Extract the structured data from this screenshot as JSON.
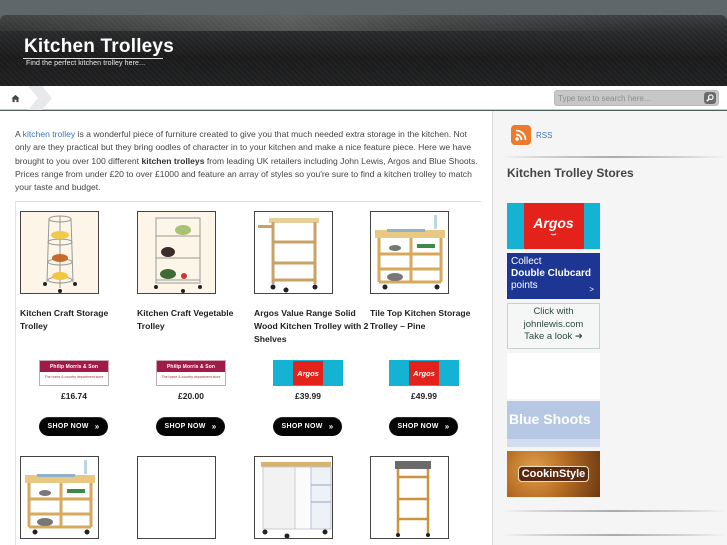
{
  "header": {
    "site_title": "Kitchen Trolleys",
    "tagline": "Find the perfect kitchen trolley here..."
  },
  "navbar": {
    "home_icon": "home-icon",
    "search": {
      "placeholder": "Type text to search here...",
      "value": "",
      "button_icon": "search-icon"
    }
  },
  "intro": {
    "prefix": "A ",
    "link_text": "kitchen trolley",
    "part1": " is a wonderful piece of furniture created to give you that much needed extra storage in the kitchen. Not only are they practical but they bring oodles of character in to your kitchen and make a nice feature piece. Here we have brought to you over 100 different ",
    "bold_text": "kitchen trolleys",
    "part2": " from leading UK retailers including John Lewis, Argos and Blue Shoots. Prices range from under £20 to over £1000 and feature an array of styles so you're sure to find a kitchen trolley to match your taste and budget."
  },
  "products": [
    {
      "name": "Kitchen Craft Storage Trolley",
      "retailer": "Philip Morris & Son",
      "retailer_sub": "The home & country department store",
      "price": "£16.74",
      "shop_label": "SHOP NOW",
      "shop_icon": "double-chevron-right-icon",
      "image": "chrome-3-tier-round-basket-trolley"
    },
    {
      "name": "Kitchen Craft Vegetable Trolley",
      "retailer": "Philip Morris & Son",
      "retailer_sub": "The home & country department store",
      "price": "£20.00",
      "shop_label": "SHOP NOW",
      "shop_icon": "double-chevron-right-icon",
      "image": "chrome-3-tier-vegetable-trolley"
    },
    {
      "name": "Argos Value Range Solid Wood Kitchen Trolley with 2 Shelves",
      "retailer": "Argos",
      "price": "£39.99",
      "shop_label": "SHOP NOW",
      "shop_icon": "double-chevron-right-icon",
      "image": "wooden-trolley-2-shelves"
    },
    {
      "name": "Tile Top Kitchen Storage Trolley – Pine",
      "retailer": "Argos",
      "price": "£49.99",
      "shop_label": "SHOP NOW",
      "shop_icon": "double-chevron-right-icon",
      "image": "pine-tile-top-trolley"
    }
  ],
  "products_row2": [
    {
      "image": "pine-tile-top-trolley"
    },
    {
      "image": "blank"
    },
    {
      "image": "white-cabinet-trolley"
    },
    {
      "image": "granite-top-tall-trolley"
    }
  ],
  "sidebar": {
    "rss_label": "RSS",
    "stores_heading": "Kitchen Trolley Stores",
    "banners": [
      {
        "name": "Argos",
        "text": "Argos"
      },
      {
        "name": "Tesco Clubcard",
        "line1": "Collect",
        "line2": "Double Clubcard",
        "line3": "points",
        "arrow": ">"
      },
      {
        "name": "John Lewis",
        "line1": "Click with",
        "line2": "johnlewis.com",
        "line3": "Take a look ➜"
      },
      {
        "name": "Blank",
        "text": ""
      },
      {
        "name": "Blue Shoots",
        "text": "Blue Shoots"
      },
      {
        "name": "CookinStyle",
        "text": "CookinStyle"
      }
    ]
  }
}
